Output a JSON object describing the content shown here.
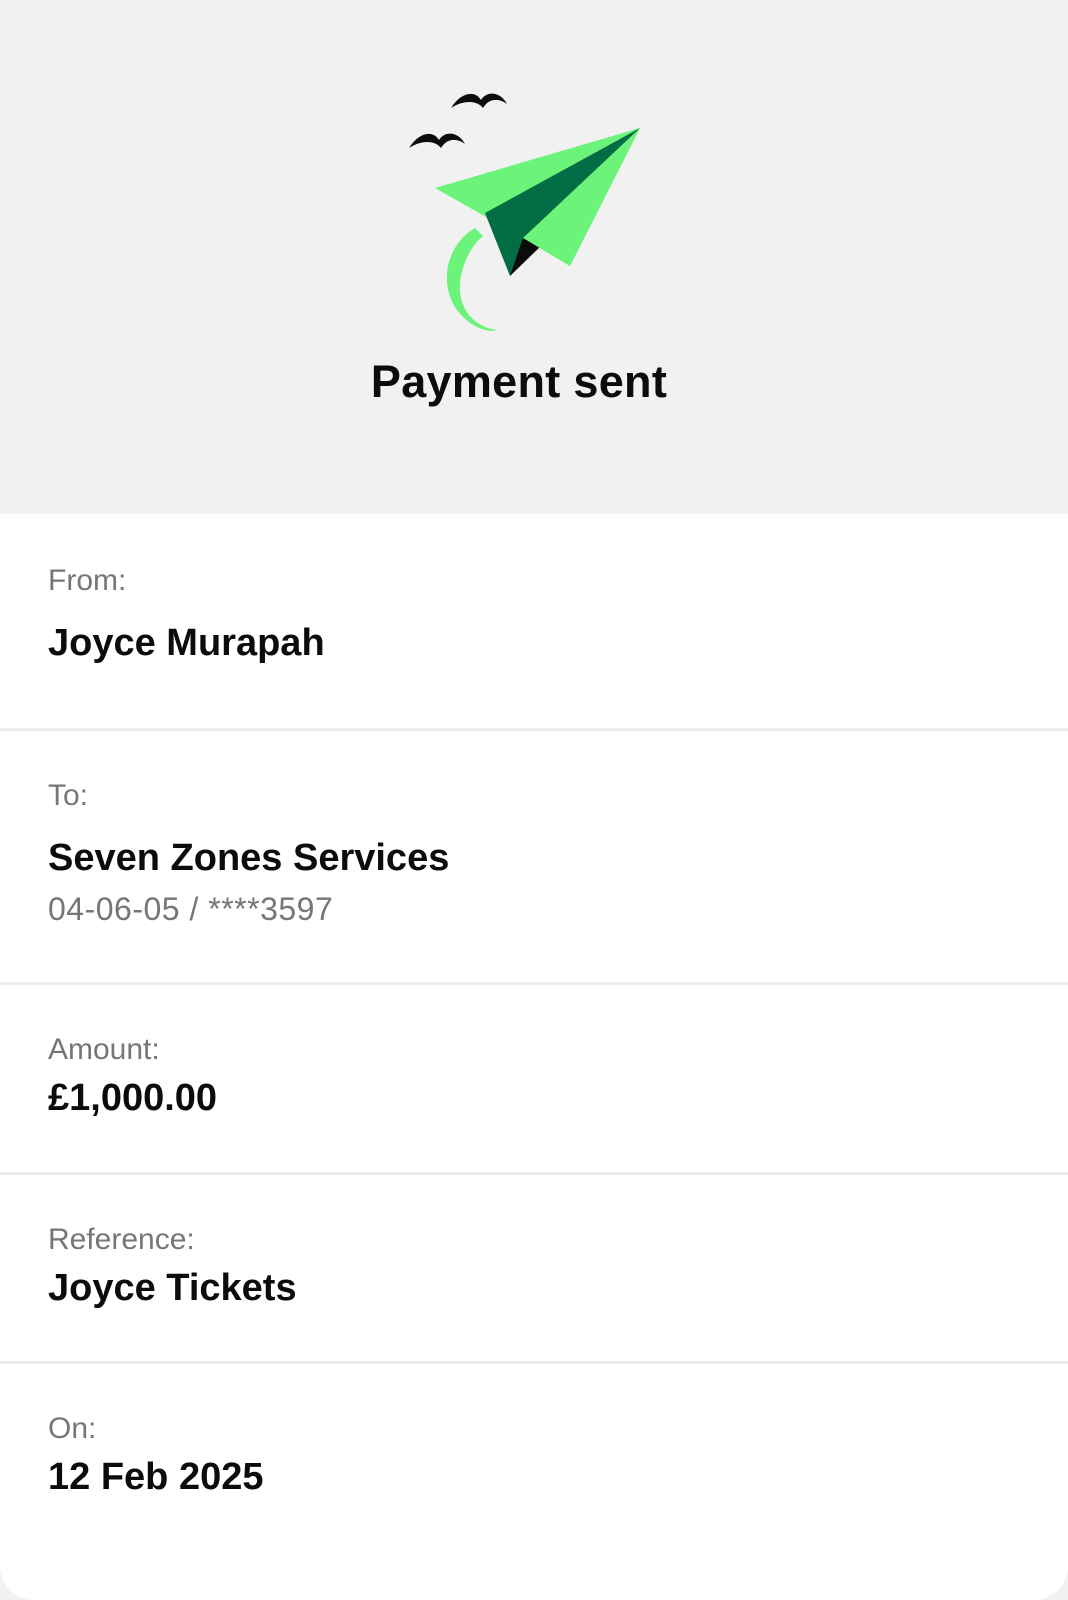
{
  "hero": {
    "title": "Payment sent",
    "illustration_icon": "paper-plane-with-birds-icon",
    "colors": {
      "plane_light": "#6cf47a",
      "plane_dark": "#026c45",
      "ink": "#0c0c0c"
    }
  },
  "details": {
    "from": {
      "label": "From:",
      "value": "Joyce Murapah"
    },
    "to": {
      "label": "To:",
      "value": "Seven Zones Services",
      "account": "04-06-05 / ****3597"
    },
    "amount": {
      "label": "Amount:",
      "value": "£1,000.00"
    },
    "reference": {
      "label": "Reference:",
      "value": "Joyce Tickets"
    },
    "on": {
      "label": "On:",
      "value": "12 Feb 2025"
    }
  }
}
